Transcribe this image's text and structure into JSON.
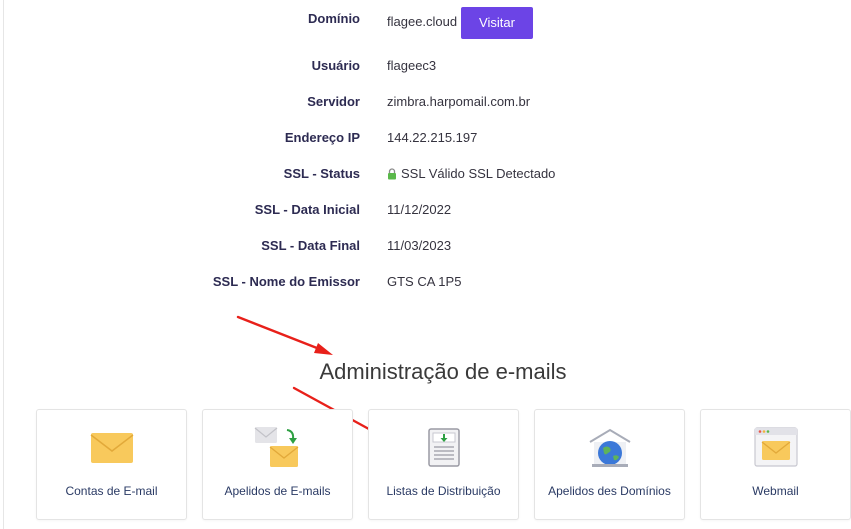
{
  "details": [
    {
      "key": "domain",
      "label": "Domínio",
      "value": "flagee.cloud"
    },
    {
      "key": "user",
      "label": "Usuário",
      "value": "flageec3"
    },
    {
      "key": "server",
      "label": "Servidor",
      "value": "zimbra.harpomail.com.br"
    },
    {
      "key": "ip",
      "label": "Endereço IP",
      "value": "144.22.215.197"
    },
    {
      "key": "ssl_status",
      "label": "SSL - Status",
      "value": "SSL Válido SSL Detectado"
    },
    {
      "key": "ssl_start",
      "label": "SSL - Data Inicial",
      "value": "11/12/2022"
    },
    {
      "key": "ssl_end",
      "label": "SSL - Data Final",
      "value": "11/03/2023"
    },
    {
      "key": "ssl_issuer",
      "label": "SSL - Nome do Emissor",
      "value": "GTS CA 1P5"
    }
  ],
  "visit_button": "Visitar",
  "section_title": "Administração de e-mails",
  "cards": [
    {
      "label": "Contas de E-mail",
      "icon": "envelope-icon"
    },
    {
      "label": "Apelidos de E-mails",
      "icon": "email-forward-icon"
    },
    {
      "label": "Listas de Distribuição",
      "icon": "distribution-list-icon"
    },
    {
      "label": "Apelidos des Domínios",
      "icon": "globe-icon"
    },
    {
      "label": "Webmail",
      "icon": "webmail-icon"
    }
  ],
  "colors": {
    "accent": "#6c44e6",
    "label": "#2d2b52",
    "card_label": "#2a3a64",
    "envelope": "#f8c95c",
    "arrow": "#e8201a",
    "lock": "#5ab84a"
  }
}
